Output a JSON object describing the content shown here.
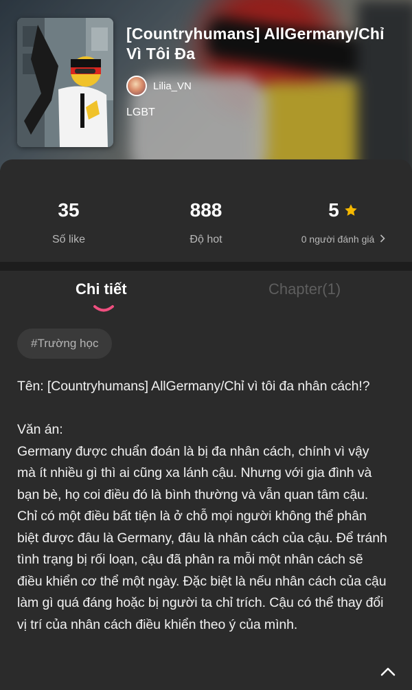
{
  "story": {
    "title": "[Countryhumans] AllGermany/Chỉ Vì Tôi Đa",
    "author": "Lilia_VN",
    "genre": "LGBT"
  },
  "stats": {
    "likes": {
      "value": "35",
      "label": "Số like"
    },
    "hot": {
      "value": "888",
      "label": "Độ hot"
    },
    "rating": {
      "value": "5",
      "label": "0 người đánh giá"
    }
  },
  "tabs": {
    "detail": "Chi tiết",
    "chapters": "Chapter(1)"
  },
  "tag": "#Trường học",
  "description": "Tên: [Countryhumans] AllGermany/Chỉ vì tôi đa nhân cách!?\n\nVăn án:\nGermany được chuẩn đoán là bị đa nhân cách, chính vì vậy mà ít nhiều gì thì ai cũng xa lánh cậu. Nhưng với gia đình và bạn bè, họ coi điều đó là bình thường và vẫn quan tâm cậu. Chỉ có một điều bất tiện là ở chỗ mọi người không thể phân biệt được đâu là Germany, đâu là nhân cách của cậu. Để tránh tình trạng bị rối loạn, cậu đã phân ra mỗi một nhân cách sẽ điều khiển cơ thể một ngày. Đặc biệt là nếu nhân cách của cậu làm gì quá đáng hoặc bị người ta chỉ trích. Cậu có thể thay đổi vị trí của nhân cách điều khiển theo ý của mình.",
  "icons": {
    "star": "star-icon",
    "chevron": "chevron-right-icon",
    "scroll_top": "chevron-up-icon"
  },
  "colors": {
    "background": "#2b2b2b",
    "star": "#f5b800",
    "tab_indicator": "#ef4f7f"
  }
}
